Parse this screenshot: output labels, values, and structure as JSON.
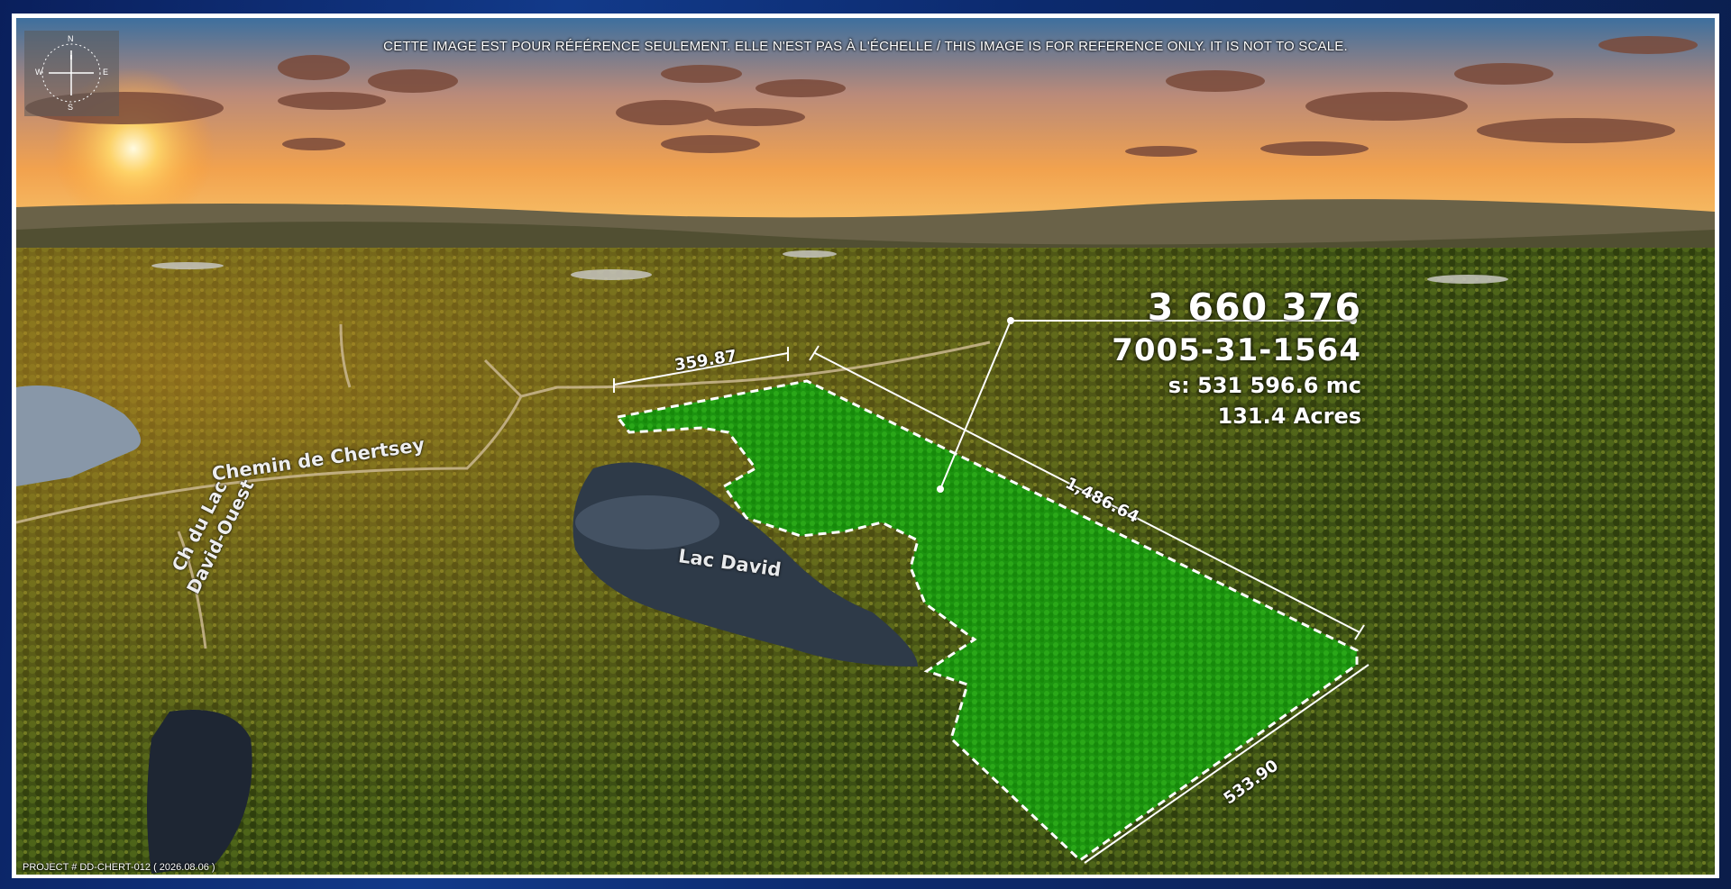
{
  "disclaimer": "CETTE IMAGE EST POUR RÉFÉRENCE SEULEMENT. ELLE N'EST PAS À L'ÉCHELLE / THIS IMAGE IS FOR REFERENCE ONLY. IT IS NOT TO SCALE.",
  "compass": {
    "n": "N",
    "s": "S",
    "e": "E",
    "w": "W"
  },
  "parcel": {
    "lot_number": "3 660 376",
    "matricule": "7005-31-1564",
    "surface": "s: 531 596.6 mc",
    "acres": "131.4 Acres",
    "highlight_color": "#1f9a10"
  },
  "dimensions": {
    "north": "359.87",
    "northeast": "1,486.64",
    "southeast": "533.90"
  },
  "labels": {
    "road_chertsey": "Chemin de Chertsey",
    "road_lac_line1": "Ch du Lac",
    "road_lac_line2": "David-Ouest",
    "lake": "Lac David"
  },
  "footer": {
    "project": "PROJECT # DD-CHERT-012 ( 2026.08.06 )"
  }
}
